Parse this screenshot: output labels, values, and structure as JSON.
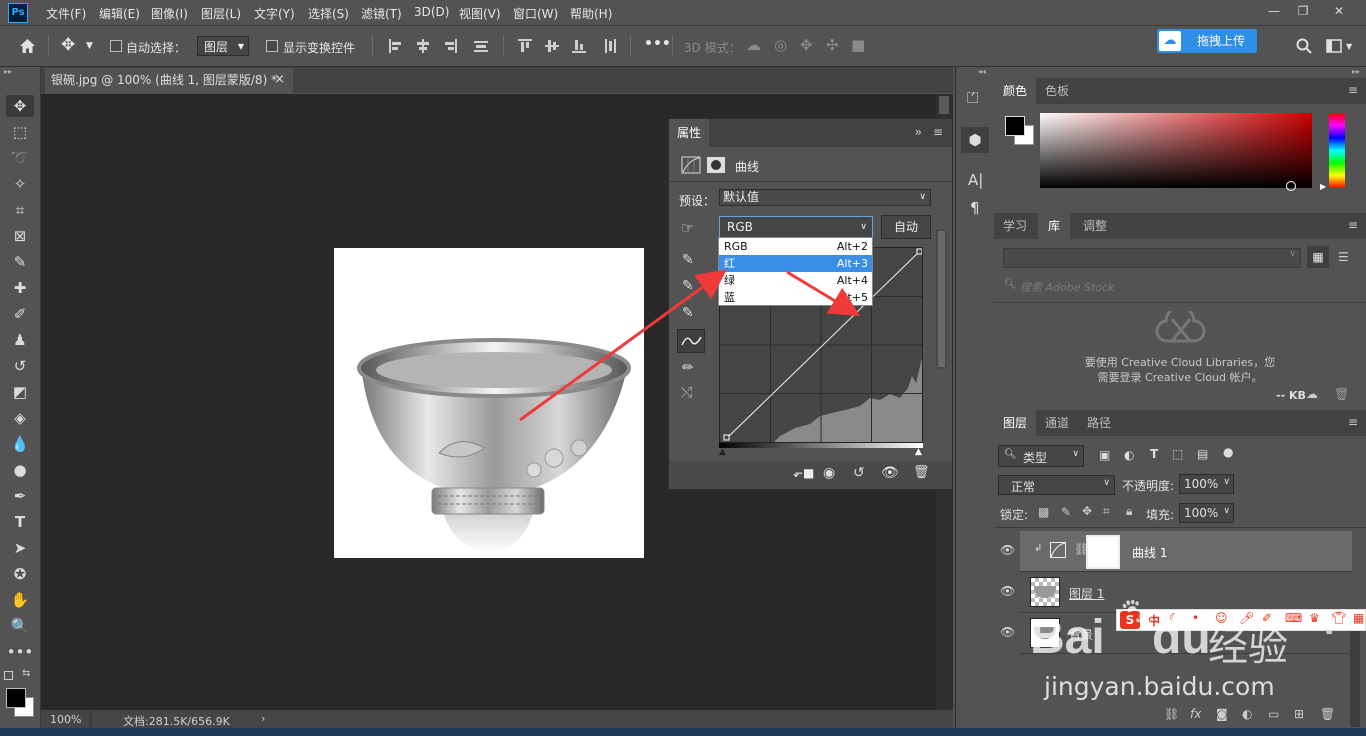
{
  "app": {
    "logo": "Ps"
  },
  "menu": [
    "文件(F)",
    "编辑(E)",
    "图像(I)",
    "图层(L)",
    "文字(Y)",
    "选择(S)",
    "滤镜(T)",
    "3D(D)",
    "视图(V)",
    "窗口(W)",
    "帮助(H)"
  ],
  "options_bar": {
    "auto_select_label": "自动选择：",
    "auto_select_value": "图层",
    "show_transform_label": "显示变换控件",
    "more_label": "•••",
    "mode_3d_label": "3D 模式：",
    "upload_label": "拖拽上传"
  },
  "document": {
    "tab_title": "银碗.jpg @ 100% (曲线 1, 图层蒙版/8) *",
    "tab_close": "×",
    "zoom": "100%",
    "doc_size": "文档:281.5K/656.9K",
    "status_arrow": "›"
  },
  "properties": {
    "tab_label": "属性",
    "panel_type": "曲线",
    "preset_label": "预设：",
    "preset_value": "默认值",
    "channel_value": "RGB",
    "auto_label": "自动",
    "channel_options": [
      {
        "name": "RGB",
        "shortcut": "Alt+2"
      },
      {
        "name": "红",
        "shortcut": "Alt+3"
      },
      {
        "name": "绿",
        "shortcut": "Alt+4"
      },
      {
        "name": "蓝",
        "shortcut": "Alt+5"
      }
    ],
    "selected_channel_index": 1
  },
  "color_panel": {
    "tabs": [
      "颜色",
      "色板"
    ],
    "active_tab": "颜色",
    "foreground": "#000000",
    "background": "#ffffff",
    "hue_color": "#d00000"
  },
  "library_panel": {
    "tabs": [
      "学习",
      "库",
      "调整"
    ],
    "active_tab": "库",
    "search_placeholder": "搜索 Adobe Stock",
    "message_line1": "要使用 Creative Cloud Libraries，您",
    "message_line2": "需要登录 Creative Cloud 帐户。",
    "kb_label": "-- KB"
  },
  "layers_panel": {
    "tabs": [
      "图层",
      "通道",
      "路径"
    ],
    "active_tab": "图层",
    "filter_value": "类型",
    "blend_mode": "正常",
    "opacity_label": "不透明度:",
    "opacity_value": "100%",
    "lock_label": "锁定:",
    "fill_label": "填充:",
    "fill_value": "100%",
    "layers": [
      {
        "name": "曲线 1",
        "type": "adjustment",
        "selected": true
      },
      {
        "name": "图层 1",
        "type": "pixel",
        "selected": false
      },
      {
        "name": "背景",
        "type": "background",
        "selected": false
      }
    ]
  },
  "watermark": {
    "brand": "Bai",
    "brand2": "du",
    "suffix": "经验",
    "url": "jingyan.baidu.com"
  },
  "ime_toolbar": {
    "logo": "S",
    "lang": "中"
  },
  "accent_colors": {
    "annotation_arrow": "#f03a3a",
    "highlight": "#3a8ee6"
  }
}
